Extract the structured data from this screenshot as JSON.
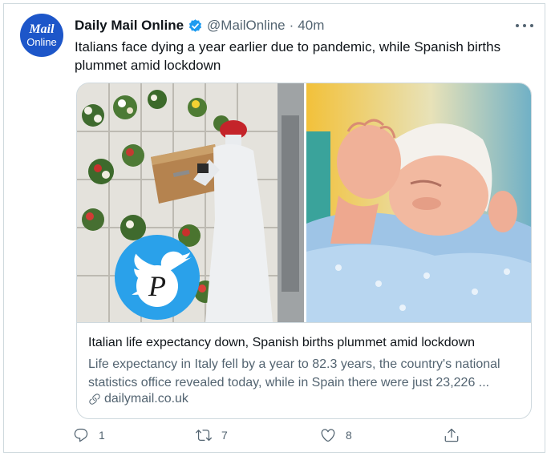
{
  "author": {
    "avatar_line1": "Mail",
    "avatar_line2": "Online",
    "name": "Daily Mail Online",
    "handle": "@MailOnline",
    "separator": "·",
    "time": "40m"
  },
  "tweet": {
    "text": "Italians face dying a year earlier due to pandemic, while Spanish births plummet amid lockdown"
  },
  "card": {
    "title": "Italian life expectancy down, Spanish births plummet amid lockdown",
    "description": "Life expectancy in Italy fell by a year to 82.3 years, the country's national statistics office revealed today, while in Spain there were just 23,226 ...",
    "domain": "dailymail.co.uk",
    "overlay_letter": "P"
  },
  "actions": {
    "reply_count": "1",
    "retweet_count": "7",
    "like_count": "8"
  },
  "colors": {
    "accent": "#1d9bf0",
    "text_secondary": "#536471",
    "border": "#cfd9de",
    "avatar_bg": "#1d56c9"
  },
  "icons": [
    "verified-badge-icon",
    "more-icon",
    "link-icon",
    "reply-icon",
    "retweet-icon",
    "like-icon",
    "share-icon",
    "twitter-bird-icon"
  ]
}
